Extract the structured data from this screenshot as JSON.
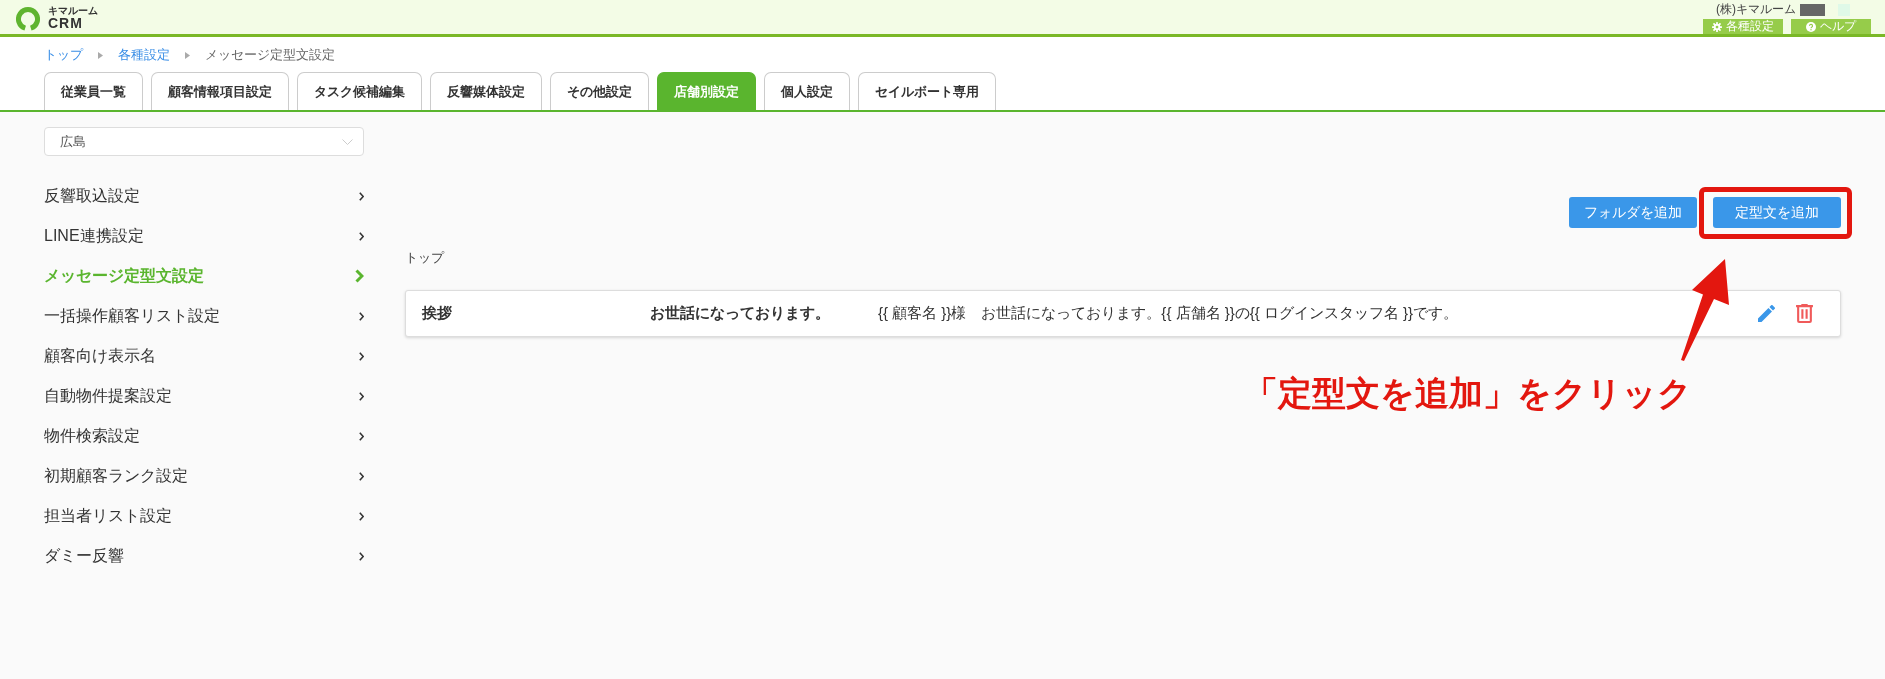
{
  "header": {
    "logo": {
      "kana": "キマルーム",
      "name": "CRM"
    },
    "company": "(株)キマルーム",
    "buttons": [
      {
        "kind": "settings",
        "label": "各種設定"
      },
      {
        "kind": "help",
        "label": "ヘルプ"
      }
    ]
  },
  "breadcrumb": [
    {
      "label": "トップ",
      "current": false
    },
    {
      "label": "各種設定",
      "current": false
    },
    {
      "label": "メッセージ定型文設定",
      "current": true
    }
  ],
  "tabs": [
    {
      "label": "従業員一覧",
      "selected": false
    },
    {
      "label": "顧客情報項目設定",
      "selected": false
    },
    {
      "label": "タスク候補編集",
      "selected": false
    },
    {
      "label": "反響媒体設定",
      "selected": false
    },
    {
      "label": "その他設定",
      "selected": false
    },
    {
      "label": "店舗別設定",
      "selected": true
    },
    {
      "label": "個人設定",
      "selected": false
    },
    {
      "label": "セイルボート専用",
      "selected": false
    }
  ],
  "sidebar": {
    "store_select": {
      "value": "広島"
    },
    "items": [
      {
        "label": "反響取込設定",
        "selected": false
      },
      {
        "label": "LINE連携設定",
        "selected": false
      },
      {
        "label": "メッセージ定型文設定",
        "selected": true
      },
      {
        "label": "一括操作顧客リスト設定",
        "selected": false
      },
      {
        "label": "顧客向け表示名",
        "selected": false
      },
      {
        "label": "自動物件提案設定",
        "selected": false
      },
      {
        "label": "物件検索設定",
        "selected": false
      },
      {
        "label": "初期顧客ランク設定",
        "selected": false
      },
      {
        "label": "担当者リスト設定",
        "selected": false
      },
      {
        "label": "ダミー反響",
        "selected": false
      }
    ]
  },
  "actions": [
    {
      "label": "フォルダを追加",
      "highlighted": false
    },
    {
      "label": "定型文を追加",
      "highlighted": true
    }
  ],
  "folder_path": "トップ",
  "templates": [
    {
      "name": "挨拶",
      "subject": "お世話になっております。",
      "body": "{{ 顧客名 }}様　お世話になっております。{{ 店舗名 }}の{{ ログインスタッフ名 }}です。"
    }
  ],
  "callout": {
    "text": "「定型文を追加」をクリック"
  }
}
